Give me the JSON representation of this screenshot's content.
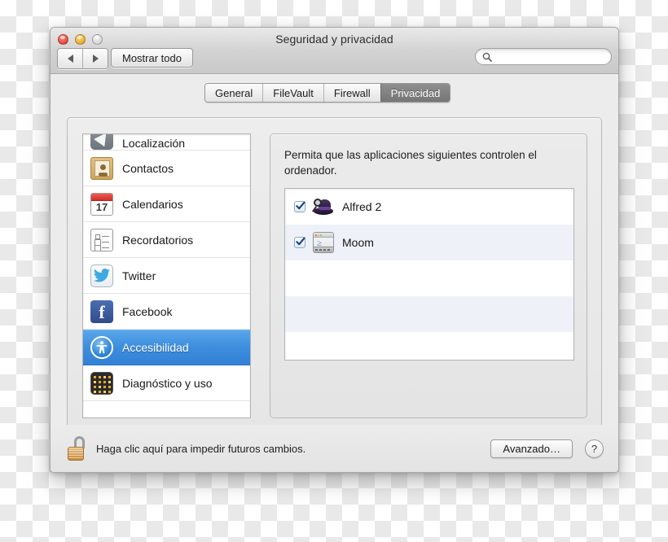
{
  "window": {
    "title": "Seguridad y privacidad",
    "traffic_lights": [
      "close-button",
      "minimize-button",
      "zoom-button"
    ]
  },
  "toolbar": {
    "back_icon": "back-arrow-icon",
    "forward_icon": "forward-arrow-icon",
    "show_all_label": "Mostrar todo",
    "search": {
      "icon": "search-icon",
      "value": "",
      "placeholder": ""
    }
  },
  "tabs": [
    {
      "label": "General",
      "selected": false
    },
    {
      "label": "FileVault",
      "selected": false
    },
    {
      "label": "Firewall",
      "selected": false
    },
    {
      "label": "Privacidad",
      "selected": true
    }
  ],
  "sidebar": {
    "items": [
      {
        "label": "Localización",
        "icon": "location-arrow-icon",
        "selected": false,
        "clipped": true
      },
      {
        "label": "Contactos",
        "icon": "contacts-book-icon",
        "selected": false
      },
      {
        "label": "Calendarios",
        "icon": "calendar-icon",
        "icon_day": "17",
        "selected": false
      },
      {
        "label": "Recordatorios",
        "icon": "reminders-checklist-icon",
        "selected": false
      },
      {
        "label": "Twitter",
        "icon": "twitter-bird-icon",
        "selected": false
      },
      {
        "label": "Facebook",
        "icon": "facebook-f-icon",
        "selected": false
      },
      {
        "label": "Accesibilidad",
        "icon": "accessibility-icon",
        "selected": true
      },
      {
        "label": "Diagnóstico y uso",
        "icon": "diagnostics-icon",
        "selected": false
      }
    ]
  },
  "main": {
    "description": "Permita que las aplicaciones siguientes controlen el ordenador.",
    "apps": [
      {
        "name": "Alfred 2",
        "icon": "alfred-hat-icon",
        "checked": true
      },
      {
        "name": "Moom",
        "icon": "moom-window-icon",
        "checked": true
      }
    ],
    "empty_row_count": 3
  },
  "bottom": {
    "lock_icon": "padlock-open-icon",
    "lock_text": "Haga clic aquí para impedir futuros cambios.",
    "advanced_label": "Avanzado…",
    "help_label": "?"
  },
  "colors": {
    "selection_blue": "#3e8ddd",
    "tab_selected_gray": "#7d7d7d",
    "window_chrome": "#ececec",
    "list_alt_row": "#eef2f8",
    "lock_gold": "#d0913f"
  }
}
